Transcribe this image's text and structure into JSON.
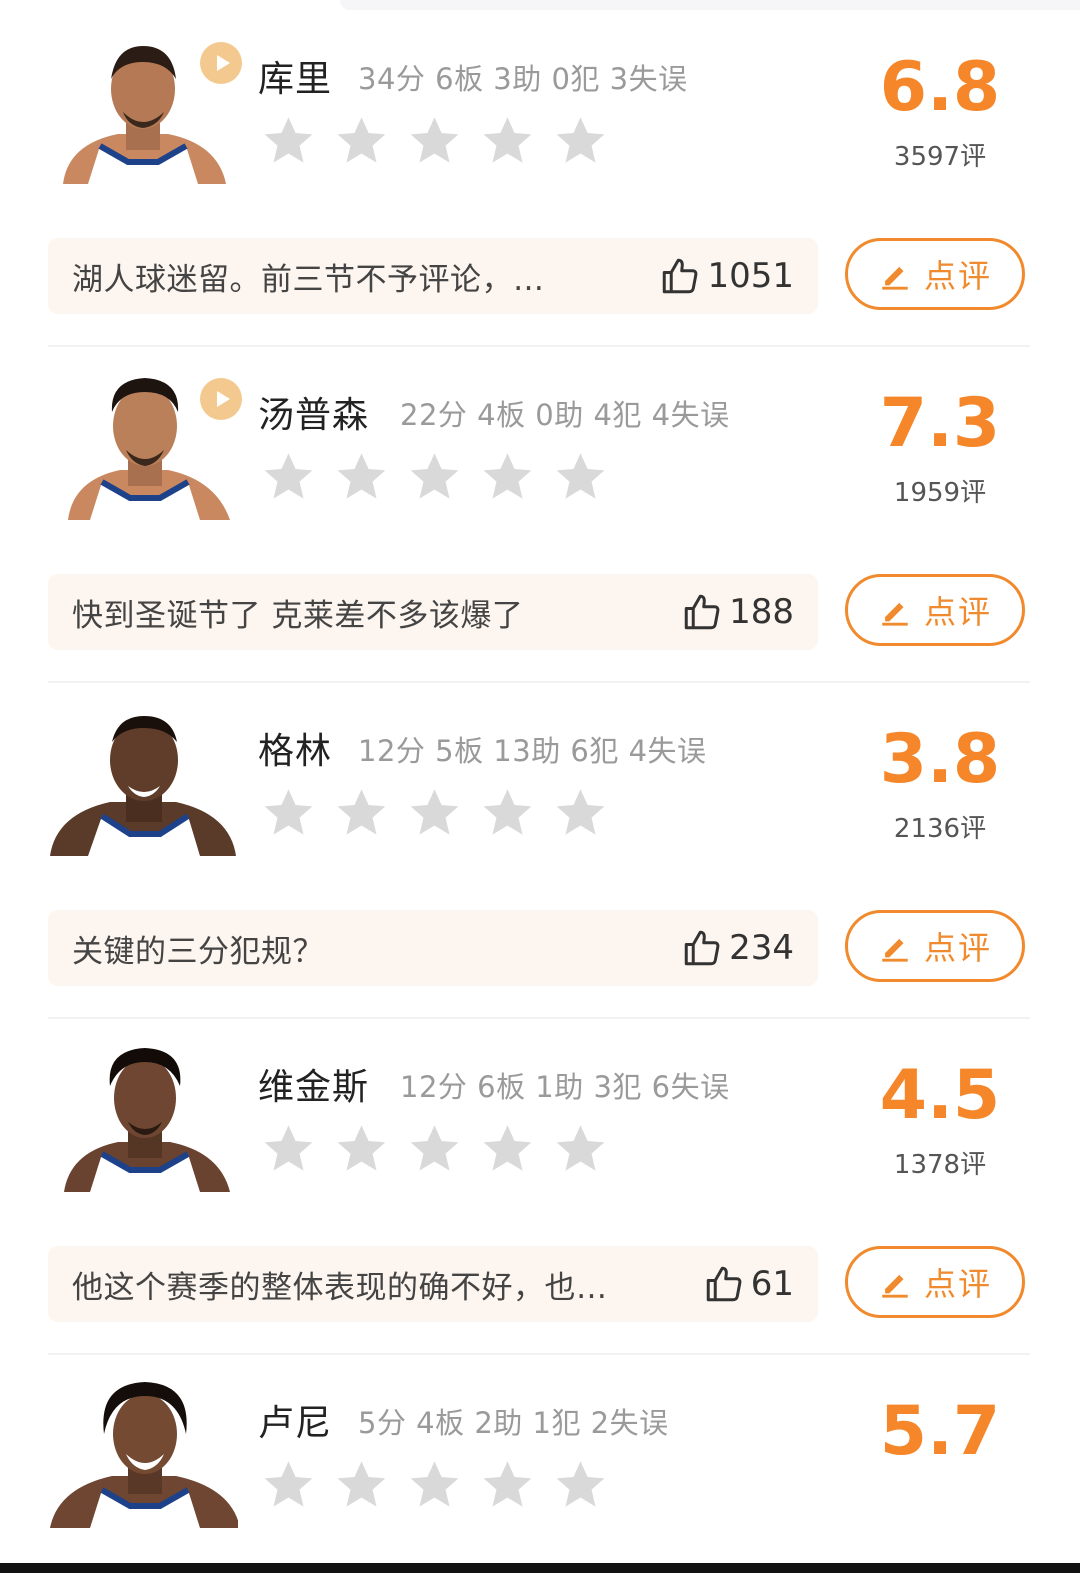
{
  "colors": {
    "accent": "#f5872a",
    "star": "#d9d9d9",
    "comment_bg": "#fdf5ef",
    "play_badge": "#f3c98f"
  },
  "players": [
    {
      "name": "库里",
      "stats": "34分 6板 3助 0犯 3失误",
      "score": "6.8",
      "ratings": "3597评",
      "has_video": true,
      "comment": {
        "text": "湖人球迷留。前三节不予评论，…",
        "likes": "1051"
      },
      "review_label": "点评"
    },
    {
      "name": "汤普森",
      "stats": "22分 4板 0助 4犯 4失误",
      "score": "7.3",
      "ratings": "1959评",
      "has_video": true,
      "comment": {
        "text": "快到圣诞节了 克莱差不多该爆了",
        "likes": "188"
      },
      "review_label": "点评"
    },
    {
      "name": "格林",
      "stats": "12分 5板 13助 6犯 4失误",
      "score": "3.8",
      "ratings": "2136评",
      "has_video": false,
      "comment": {
        "text": "关键的三分犯规？",
        "likes": "234"
      },
      "review_label": "点评"
    },
    {
      "name": "维金斯",
      "stats": "12分 6板 1助 3犯 6失误",
      "score": "4.5",
      "ratings": "1378评",
      "has_video": false,
      "comment": {
        "text": "他这个赛季的整体表现的确不好，也…",
        "likes": "61"
      },
      "review_label": "点评"
    },
    {
      "name": "卢尼",
      "stats": "5分 4板 2助 1犯 2失误",
      "score": "5.7",
      "has_video": false
    }
  ]
}
